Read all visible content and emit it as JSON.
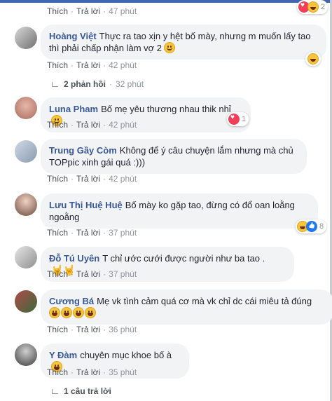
{
  "labels": {
    "like": "Thích",
    "reply": "Trả lời",
    "dot": "·"
  },
  "comments": [
    {
      "id": 0,
      "time": "47 phút",
      "reaction": {
        "count": "2",
        "icons": [
          "heart-icon",
          "haha-icon"
        ]
      }
    },
    {
      "id": 1,
      "name": "Hoàng Việt",
      "text": "Thực ra tao xịn y hệt bố mày, nhưng m muốn lấy tao thì phải chấp nhận làm vợ 2",
      "time": "42 phút",
      "emoji": "smirk-emoji",
      "reaction": {
        "icons": [
          "haha-icon"
        ]
      }
    },
    {
      "id": 2,
      "name": "Luna Pham",
      "text": "Bố mẹ yêu thương nhau thik nhỉ",
      "time": "42 phút",
      "emoji": "smile-emoji",
      "reaction": {
        "count": "1",
        "icons": [
          "heart-icon"
        ]
      }
    },
    {
      "id": 3,
      "name": "Trung Gầy Còm",
      "text": "Không để ý câu chuyện lắm nhưng mà chủ TOPpic xinh gái quá :)))",
      "time": "42 phút"
    },
    {
      "id": 4,
      "name": "Lưu Thị Huệ Huệ",
      "text": "Bố mày ko gặp tao, đừng có đổ oan loằng ngoằng",
      "time": "37 phút",
      "reaction": {
        "count": "8",
        "icons": [
          "haha-icon",
          "like-icon"
        ]
      }
    },
    {
      "id": 5,
      "name": "Đỗ Tú Uyên",
      "text": "T chỉ ước cưới được người như ba tao .",
      "time": "37 phút",
      "emoji": "rock-hands-emoji"
    },
    {
      "id": 6,
      "name": "Cương Bá",
      "text": "Mẹ vk tình cảm quá cơ mà vk chỉ dc cái miêu tả đúng",
      "time": "36 phút",
      "emoji": "laughing-emoji"
    },
    {
      "id": 7,
      "name": "Y Đàm",
      "text": "chuyên mục khoe bố à",
      "time": "35 phút",
      "emoji": "laughing-emoji"
    }
  ],
  "reply_summaries": {
    "first": {
      "text": "2 phản hồi",
      "time": "32 phút"
    },
    "last": {
      "text": "1 câu trả lời"
    }
  },
  "colors": {
    "name": "#385898",
    "bubble": "#f2f3f5",
    "meta": "#90949c",
    "fb_blue": "#4267b2"
  }
}
